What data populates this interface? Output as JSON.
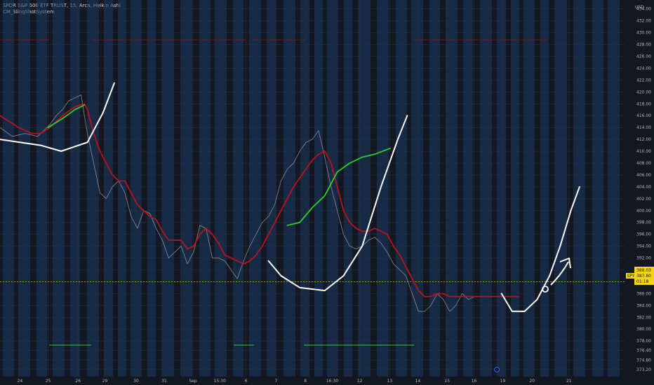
{
  "legend": {
    "symbol_line": "SPDR S&P 500 ETF TRUST, 15, Arca, Heikin Ashi",
    "indicator": "CM_SlingShotSystem"
  },
  "price_axis": {
    "currency": "USD"
  },
  "price_tags": {
    "symbol": "SPY",
    "price": "387.80",
    "countdown": "01:18",
    "level": "388.03"
  },
  "chart_data": {
    "type": "line",
    "ylim": [
      372.0,
      435.5
    ],
    "yticks": [
      "373.20",
      "374.80",
      "376.40",
      "378.00",
      "380.00",
      "382.00",
      "384.00",
      "386.00",
      "388.00",
      "390.00",
      "392.00",
      "394.00",
      "396.00",
      "398.00",
      "400.00",
      "402.00",
      "404.00",
      "406.00",
      "408.00",
      "410.00",
      "412.00",
      "414.00",
      "416.00",
      "418.00",
      "420.00",
      "422.00",
      "424.00",
      "426.00",
      "428.00",
      "430.00",
      "432.00",
      "434.00"
    ],
    "xticks": [
      "24",
      "25",
      "26",
      "29",
      "30",
      "31",
      "Sep",
      "15:30",
      "6",
      "7",
      "8",
      "16:30",
      "12",
      "13",
      "14",
      "15",
      "16",
      "19",
      "20",
      "21"
    ],
    "x_range": [
      0,
      100
    ],
    "xtick_positions": [
      3.2,
      7.7,
      12.5,
      16.8,
      21.8,
      26.3,
      30.9,
      35.2,
      39.4,
      44.2,
      48.9,
      53.2,
      57.6,
      62.4,
      66.9,
      71.6,
      75.9,
      80.5,
      85.2,
      91.1
    ],
    "grid": true,
    "series": [
      {
        "color": "#c0c0c0",
        "x": [
          0,
          2,
          4,
          6,
          7,
          8,
          9,
          10,
          11,
          12,
          13,
          13.5,
          14,
          15,
          16,
          17,
          18,
          19,
          20,
          21,
          22,
          23,
          24,
          25,
          26,
          27,
          28,
          29,
          30,
          31,
          32,
          33,
          34,
          35,
          36,
          37,
          38,
          39,
          40,
          41,
          42,
          43,
          44,
          45,
          46,
          47,
          48,
          49,
          50,
          51,
          52,
          53,
          54,
          55,
          56,
          57,
          58,
          59,
          60,
          61,
          62,
          63,
          64,
          65,
          66,
          67,
          68,
          69,
          70,
          71,
          72,
          73,
          74,
          75,
          76,
          77,
          78,
          79,
          80,
          81,
          82,
          83
        ],
        "y": [
          414,
          412.5,
          413,
          412.5,
          413.5,
          414.5,
          416,
          417,
          418.5,
          419,
          419.5,
          416,
          413,
          408,
          403,
          402,
          404,
          405,
          403,
          399,
          397,
          400,
          399.5,
          397,
          395,
          392,
          393,
          394,
          391,
          393,
          397.5,
          397,
          392,
          392,
          391.5,
          390,
          388.5,
          391.5,
          394,
          396,
          398,
          399,
          401,
          405,
          407,
          408,
          410,
          411.5,
          412,
          413.5,
          409,
          404,
          400,
          396,
          394,
          393.5,
          394,
          395,
          395.5,
          394.5,
          393,
          391,
          390,
          389,
          386,
          383,
          383,
          384,
          386,
          385,
          383,
          384,
          386,
          385,
          385.5,
          385.5,
          385.5,
          385.5,
          385.5,
          385.5,
          385.5,
          385.5
        ]
      },
      {
        "color": "#b7131f",
        "x": [
          0,
          3,
          5,
          6.5,
          8,
          10,
          12,
          13.5,
          14,
          15,
          16,
          17,
          18,
          19,
          20,
          21,
          22,
          23,
          24,
          25,
          26,
          27,
          28,
          29,
          30,
          31,
          32,
          33,
          34,
          35,
          36,
          37,
          38,
          39,
          40,
          41,
          42,
          43,
          44,
          45,
          46,
          47,
          48,
          49,
          50,
          51,
          52,
          53,
          54,
          55,
          56,
          57,
          58,
          59,
          60,
          61,
          62,
          63,
          64,
          65,
          66,
          67,
          68,
          69,
          70,
          71,
          72,
          73,
          74,
          75,
          76,
          77,
          78,
          79,
          80,
          81,
          82,
          83
        ],
        "y": [
          416,
          414,
          413,
          413,
          414,
          416,
          417.5,
          418,
          417,
          413,
          410,
          408,
          406,
          405,
          405,
          403,
          401,
          400,
          399,
          398.5,
          396.5,
          395,
          395,
          395,
          393.5,
          394,
          396,
          397,
          396,
          394.5,
          392.5,
          392,
          391.5,
          391,
          391.5,
          392.5,
          394,
          396,
          398,
          400,
          402,
          404,
          405.5,
          407,
          408.5,
          409.5,
          410,
          408,
          404,
          400,
          398,
          397,
          396.5,
          396.5,
          397,
          396.5,
          396,
          394,
          392.5,
          390.5,
          388.5,
          386.5,
          385.5,
          385.5,
          386,
          386,
          385.5,
          385.5,
          385.5,
          385.5,
          385.5,
          385.5,
          385.5,
          385.5,
          385.5,
          385.5,
          385.5,
          385.5
        ]
      },
      {
        "color": "#2fcd2f",
        "x": [
          7.7,
          10,
          12,
          13.5
        ],
        "y": [
          414,
          415.5,
          417,
          417.8
        ]
      },
      {
        "color": "#2fcd2f",
        "x": [
          46,
          48,
          50,
          52,
          53,
          54,
          56,
          58,
          60,
          62.5
        ],
        "y": [
          397.5,
          398,
          400.5,
          402.5,
          404.5,
          406.5,
          408,
          409,
          409.5,
          410.5
        ]
      },
      {
        "color": "#ffffff",
        "x": [
          0,
          6.5,
          9.8,
          14,
          16.5,
          18.3
        ],
        "y": [
          412,
          411,
          410,
          411.5,
          416.5,
          421.5
        ]
      },
      {
        "color": "#ffffff",
        "x": [
          43,
          45,
          48,
          52,
          55,
          58,
          61,
          63.7,
          65.2
        ],
        "y": [
          391.5,
          389,
          387,
          386.5,
          389,
          394,
          404,
          412,
          416
        ]
      },
      {
        "color": "#ffffff",
        "x": [
          80.3,
          82,
          84,
          86,
          88,
          89.7,
          91.4,
          92.8
        ],
        "y": [
          386,
          383,
          383,
          385,
          389,
          394,
          400,
          404
        ]
      }
    ]
  }
}
